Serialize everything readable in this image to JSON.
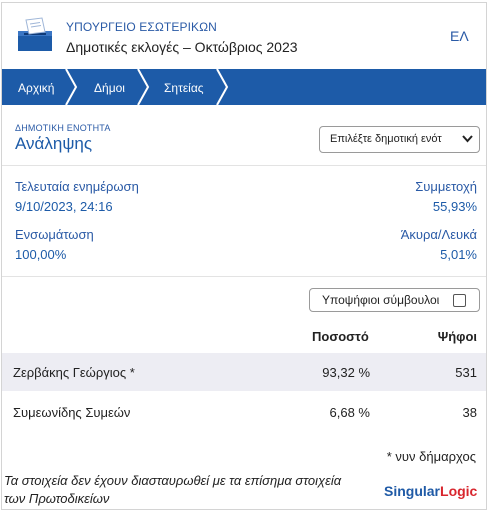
{
  "header": {
    "ministry": "ΥΠΟΥΡΓΕΙΟ ΕΣΩΤΕΡΙΚΩΝ",
    "election_title": "Δημοτικές εκλογές – Οκτώβριος 2023",
    "language": "ΕΛ",
    "logo_icon": "ballot-box-icon"
  },
  "breadcrumb": {
    "items": [
      "Αρχική",
      "Δήμοι",
      "Σητείας"
    ],
    "background": "#1d5ba8"
  },
  "unit": {
    "caption": "ΔΗΜΟΤΙΚΗ ΕΝΟΤΗΤΑ",
    "name": "Ανάληψης",
    "select_value": "Επιλέξτε δημοτική ενότ"
  },
  "stats": {
    "last_update_label": "Τελευταία ενημέρωση",
    "last_update_value": "9/10/2023, 24:16",
    "turnout_label": "Συμμετοχή",
    "turnout_value": "55,93%",
    "integration_label": "Ενσωμάτωση",
    "integration_value": "100,00%",
    "invalid_label": "Άκυρα/Λευκά",
    "invalid_value": "5,01%"
  },
  "council_toggle": {
    "label": "Υποψήφιοι σύμβουλοι",
    "checked": false
  },
  "table": {
    "headers": {
      "percent": "Ποσοστό",
      "votes": "Ψήφοι"
    },
    "rows": [
      {
        "name": "Ζερβάκης Γεώργιος *",
        "percent": "93,32 %",
        "votes": "531"
      },
      {
        "name": "Συμεωνίδης Συμεών",
        "percent": "6,68 %",
        "votes": "38"
      }
    ]
  },
  "footer": {
    "mayor_note": "* νυν δήμαρχος",
    "disclaimer": "Τα στοιχεία δεν έχουν διασταυρωθεί με τα επίσημα στοιχεία των Πρωτοδικείων",
    "brand_part1": "Singular",
    "brand_part2": "Logic"
  }
}
